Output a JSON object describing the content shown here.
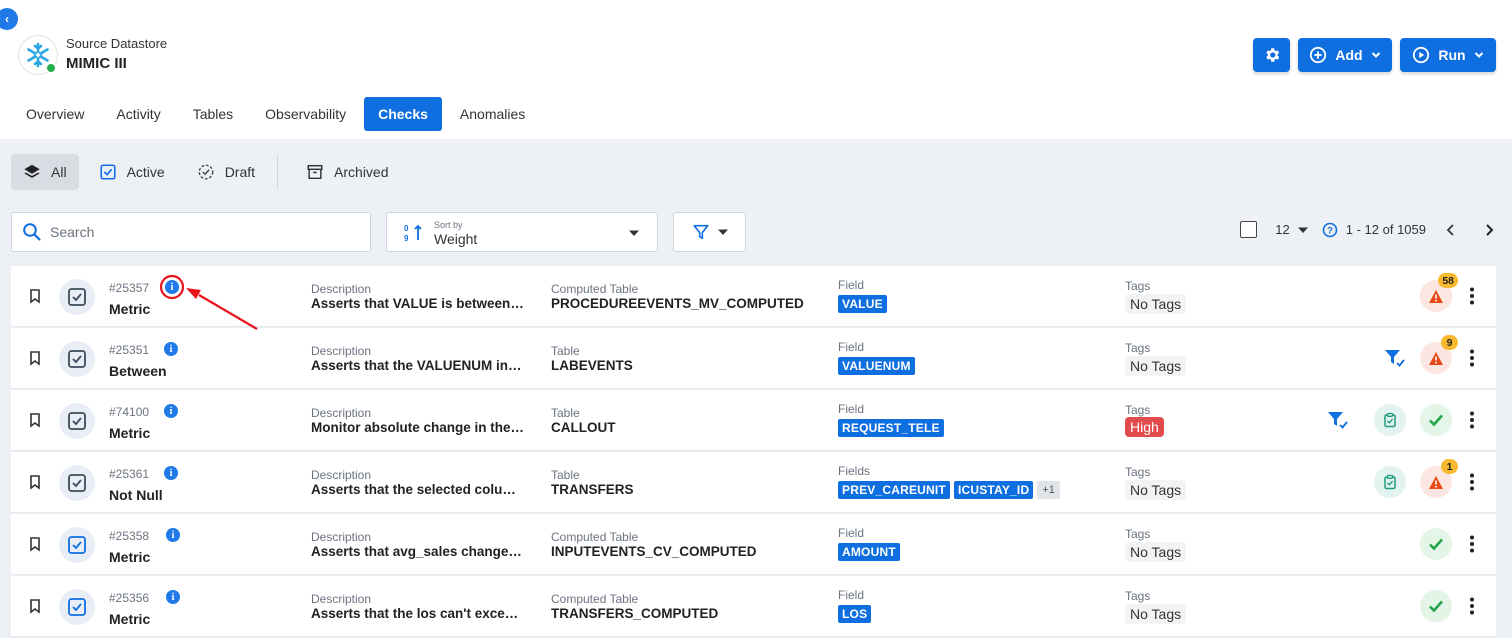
{
  "header": {
    "datastore_label": "Source Datastore",
    "datastore_name": "MIMIC III",
    "add_label": "Add",
    "run_label": "Run"
  },
  "tabs": [
    {
      "label": "Overview"
    },
    {
      "label": "Activity"
    },
    {
      "label": "Tables"
    },
    {
      "label": "Observability"
    },
    {
      "label": "Checks",
      "active": true
    },
    {
      "label": "Anomalies"
    }
  ],
  "status_filters": {
    "all": "All",
    "active": "Active",
    "draft": "Draft",
    "archived": "Archived"
  },
  "toolbar": {
    "search_placeholder": "Search",
    "sort_small_label": "Sort by",
    "sort_value": "Weight",
    "page_size": "12",
    "range_text": "1 - 12 of 1059"
  },
  "checks": [
    {
      "id": "#25357",
      "type": "Metric",
      "desc_label": "Description",
      "description": "Asserts that VALUE is between MIN and MAX",
      "table_label": "Computed Table",
      "table": "PROCEDUREEVENTS_MV_COMPUTED",
      "field_label": "Field",
      "fields": [
        "VALUE"
      ],
      "tags_label": "Tags",
      "tags": "No Tags",
      "anomaly_count": "58"
    },
    {
      "id": "#25351",
      "type": "Between",
      "desc_label": "Description",
      "description": "Asserts that the VALUENUM in the range",
      "table_label": "Table",
      "table": "LABEVENTS",
      "field_label": "Field",
      "fields": [
        "VALUENUM"
      ],
      "tags_label": "Tags",
      "tags": "No Tags",
      "anomaly_count": "9"
    },
    {
      "id": "#74100",
      "type": "Metric",
      "desc_label": "Description",
      "description": "Monitor absolute change in the metric",
      "table_label": "Table",
      "table": "CALLOUT",
      "field_label": "Field",
      "fields": [
        "REQUEST_TELE"
      ],
      "tags_label": "Tags",
      "tags": "High"
    },
    {
      "id": "#25361",
      "type": "Not Null",
      "desc_label": "Description",
      "description": "Asserts that the selected columns are not null",
      "table_label": "Table",
      "table": "TRANSFERS",
      "field_label": "Fields",
      "fields": [
        "PREV_CAREUNIT",
        "ICUSTAY_ID"
      ],
      "fields_more": "+1",
      "tags_label": "Tags",
      "tags": "No Tags",
      "anomaly_count": "1"
    },
    {
      "id": "#25358",
      "type": "Metric",
      "desc_label": "Description",
      "description": "Asserts that avg_sales changes by",
      "table_label": "Computed Table",
      "table": "INPUTEVENTS_CV_COMPUTED",
      "field_label": "Field",
      "fields": [
        "AMOUNT"
      ],
      "tags_label": "Tags",
      "tags": "No Tags"
    },
    {
      "id": "#25356",
      "type": "Metric",
      "desc_label": "Description",
      "description": "Asserts that the los can't exceed the",
      "table_label": "Computed Table",
      "table": "TRANSFERS_COMPUTED",
      "field_label": "Field",
      "fields": [
        "LOS"
      ],
      "tags_label": "Tags",
      "tags": "No Tags"
    }
  ],
  "colors": {
    "primary": "#0f6fe0",
    "warning_badge": "#f9b92e",
    "danger": "#e24b4b",
    "success": "#22b04b",
    "annotation": "#e8141a"
  }
}
